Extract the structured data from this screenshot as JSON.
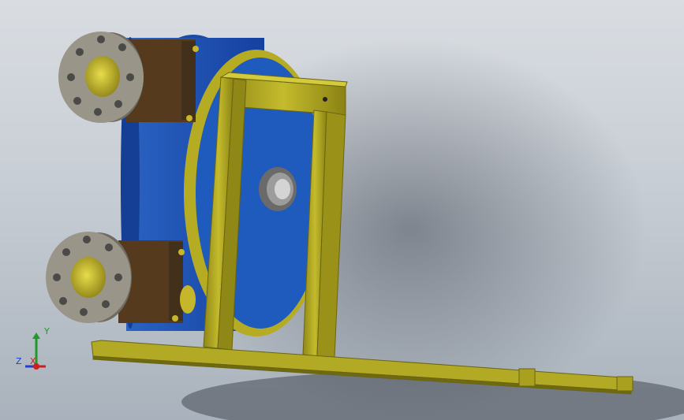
{
  "triad": {
    "x_label": "X",
    "y_label": "Y",
    "z_label": "Z",
    "x_color": "#cc1f1f",
    "y_color": "#1f9a2a",
    "z_color": "#1f3fcc"
  },
  "model": {
    "frame_color": "#a8a01e",
    "housing_color": "#1c55b0",
    "flange_color": "#9a9589",
    "bore_color": "#c6b72a",
    "reducer_color": "#553a1e"
  }
}
